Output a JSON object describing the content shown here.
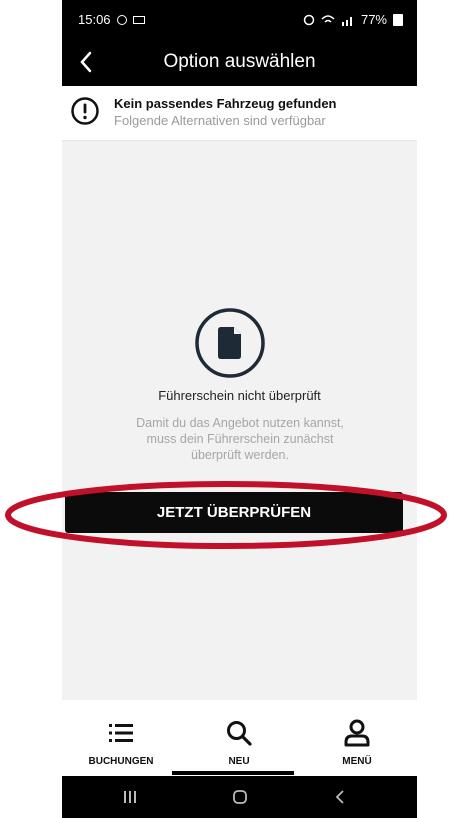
{
  "status_bar": {
    "time": "15:06",
    "battery": "77%"
  },
  "app_bar": {
    "title": "Option auswählen"
  },
  "banner": {
    "title": "Kein passendes Fahrzeug gefunden",
    "subtitle": "Folgende Alternativen sind verfügbar"
  },
  "empty_state": {
    "heading": "Führerschein nicht überprüft",
    "description": "Damit du das Angebot nutzen kannst, muss dein Führerschein zunächst überprüft werden.",
    "button_label": "JETZT ÜBERPRÜFEN"
  },
  "bottom_nav": {
    "items": [
      {
        "label": "BUCHUNGEN",
        "icon": "list-icon"
      },
      {
        "label": "NEU",
        "icon": "search-icon",
        "active": true
      },
      {
        "label": "MENÜ",
        "icon": "person-icon"
      }
    ]
  },
  "colors": {
    "accent_annotation": "#c0102a",
    "app_bar": "#000000",
    "cta_bg": "#0b0b0b"
  }
}
